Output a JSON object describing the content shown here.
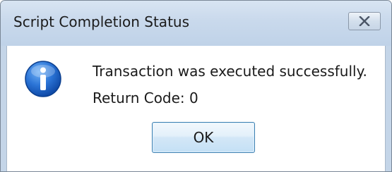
{
  "window": {
    "title": "Script Completion Status",
    "close_icon": "close-icon"
  },
  "message": {
    "icon": "info-icon",
    "line1": "Transaction was executed successfully.",
    "line2": "Return Code: 0"
  },
  "buttons": {
    "ok_label": "OK"
  },
  "colors": {
    "titlebar": "#c9d9ec",
    "content_background": "#ffffff",
    "info_icon": "#1c63c5",
    "ok_button_border": "#3c7fb1"
  }
}
